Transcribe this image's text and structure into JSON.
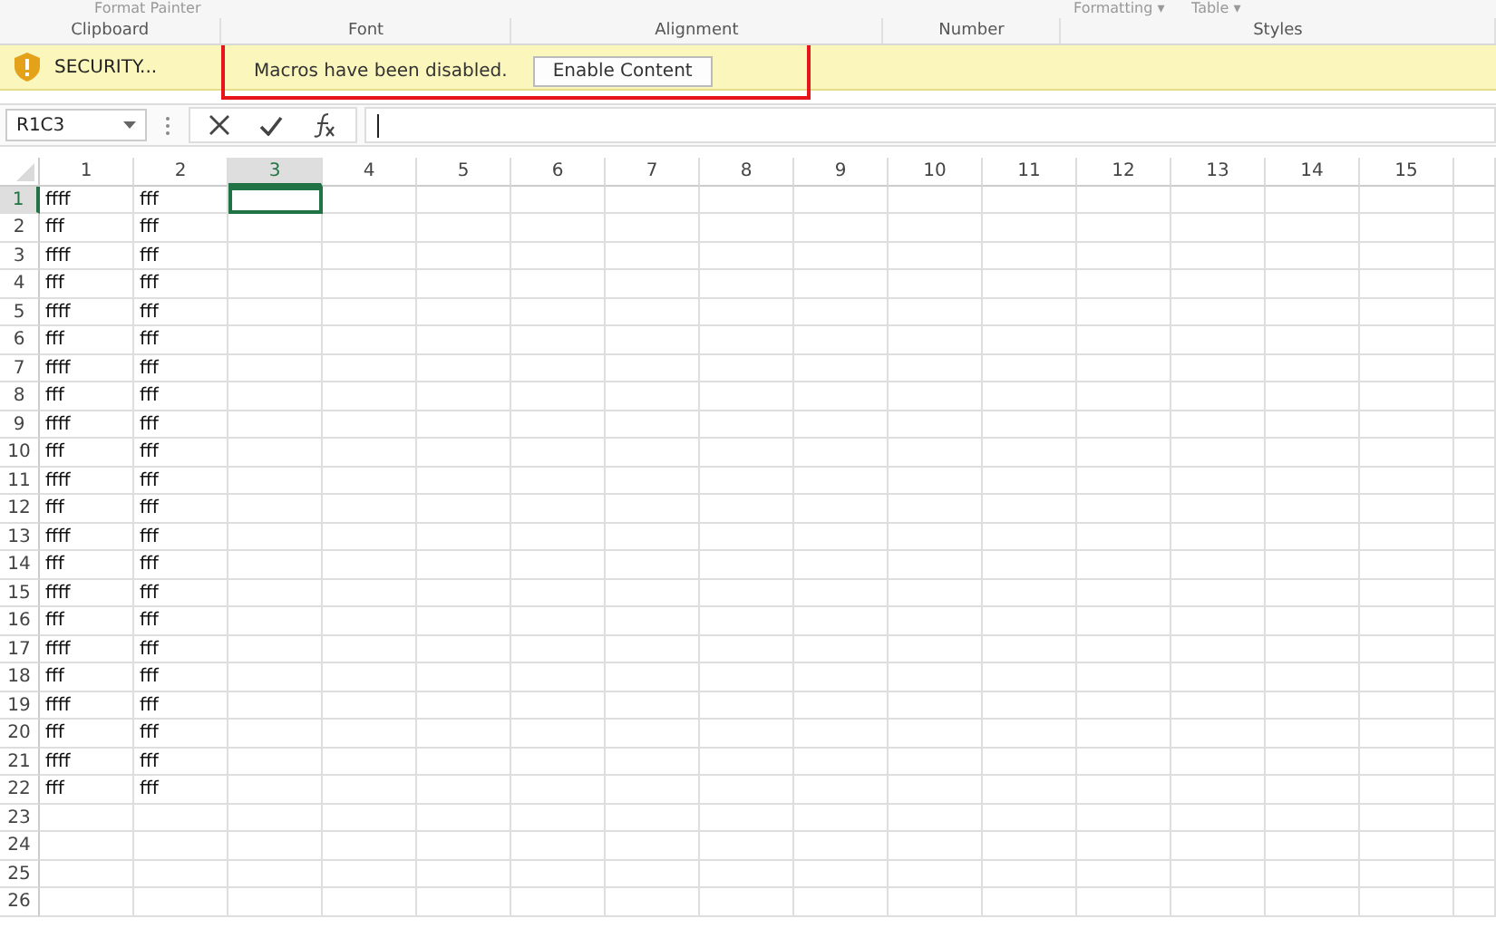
{
  "ribbon": {
    "cut_buttons": [
      "Format Painter",
      "Formatting ▾",
      "Table ▾"
    ],
    "groups": [
      "Clipboard",
      "Font",
      "Alignment",
      "Number",
      "Styles"
    ]
  },
  "message_bar": {
    "title": "SECURITY...",
    "message": "Macros have been disabled.",
    "button": "Enable Content"
  },
  "formula_bar": {
    "name_box": "R1C3"
  },
  "columns": [
    {
      "label": "1",
      "selected": false
    },
    {
      "label": "2",
      "selected": false
    },
    {
      "label": "3",
      "selected": true
    },
    {
      "label": "4",
      "selected": false
    },
    {
      "label": "5",
      "selected": false
    },
    {
      "label": "6",
      "selected": false
    },
    {
      "label": "7",
      "selected": false
    },
    {
      "label": "8",
      "selected": false
    },
    {
      "label": "9",
      "selected": false
    },
    {
      "label": "10",
      "selected": false
    },
    {
      "label": "11",
      "selected": false
    },
    {
      "label": "12",
      "selected": false
    },
    {
      "label": "13",
      "selected": false
    },
    {
      "label": "14",
      "selected": false
    },
    {
      "label": "15",
      "selected": false
    }
  ],
  "rows": [
    {
      "number": "1",
      "selected": true,
      "cells": [
        "ffff",
        "fff"
      ]
    },
    {
      "number": "2",
      "selected": false,
      "cells": [
        "fff",
        "fff"
      ]
    },
    {
      "number": "3",
      "selected": false,
      "cells": [
        "ffff",
        "fff"
      ]
    },
    {
      "number": "4",
      "selected": false,
      "cells": [
        "fff",
        "fff"
      ]
    },
    {
      "number": "5",
      "selected": false,
      "cells": [
        "ffff",
        "fff"
      ]
    },
    {
      "number": "6",
      "selected": false,
      "cells": [
        "fff",
        "fff"
      ]
    },
    {
      "number": "7",
      "selected": false,
      "cells": [
        "ffff",
        "fff"
      ]
    },
    {
      "number": "8",
      "selected": false,
      "cells": [
        "fff",
        "fff"
      ]
    },
    {
      "number": "9",
      "selected": false,
      "cells": [
        "ffff",
        "fff"
      ]
    },
    {
      "number": "10",
      "selected": false,
      "cells": [
        "fff",
        "fff"
      ]
    },
    {
      "number": "11",
      "selected": false,
      "cells": [
        "ffff",
        "fff"
      ]
    },
    {
      "number": "12",
      "selected": false,
      "cells": [
        "fff",
        "fff"
      ]
    },
    {
      "number": "13",
      "selected": false,
      "cells": [
        "ffff",
        "fff"
      ]
    },
    {
      "number": "14",
      "selected": false,
      "cells": [
        "fff",
        "fff"
      ]
    },
    {
      "number": "15",
      "selected": false,
      "cells": [
        "ffff",
        "fff"
      ]
    },
    {
      "number": "16",
      "selected": false,
      "cells": [
        "fff",
        "fff"
      ]
    },
    {
      "number": "17",
      "selected": false,
      "cells": [
        "ffff",
        "fff"
      ]
    },
    {
      "number": "18",
      "selected": false,
      "cells": [
        "fff",
        "fff"
      ]
    },
    {
      "number": "19",
      "selected": false,
      "cells": [
        "ffff",
        "fff"
      ]
    },
    {
      "number": "20",
      "selected": false,
      "cells": [
        "fff",
        "fff"
      ]
    },
    {
      "number": "21",
      "selected": false,
      "cells": [
        "ffff",
        "fff"
      ]
    },
    {
      "number": "22",
      "selected": false,
      "cells": [
        "fff",
        "fff"
      ]
    },
    {
      "number": "23",
      "selected": false,
      "cells": []
    },
    {
      "number": "24",
      "selected": false,
      "cells": []
    },
    {
      "number": "25",
      "selected": false,
      "cells": []
    },
    {
      "number": "26",
      "selected": false,
      "cells": []
    }
  ]
}
